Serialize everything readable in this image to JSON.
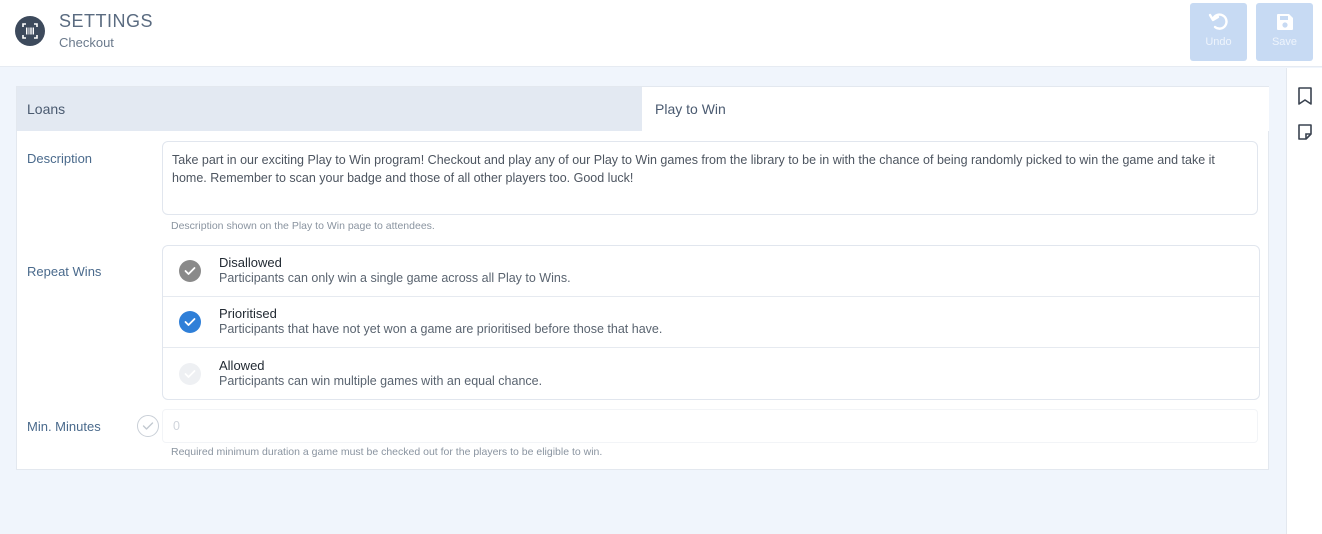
{
  "header": {
    "title": "SETTINGS",
    "subtitle": "Checkout",
    "undo_label": "Undo",
    "save_label": "Save"
  },
  "tabs": [
    {
      "label": "Loans",
      "active": false
    },
    {
      "label": "Play to Win",
      "active": true
    }
  ],
  "description": {
    "label": "Description",
    "value": "Take part in our exciting Play to Win program! Checkout and play any of our Play to Win games from the library to be in with the chance of being randomly picked to win the game and take it home. Remember to scan your badge and those of all other players too. Good luck!",
    "hint": "Description shown on the Play to Win page to attendees."
  },
  "repeat_wins": {
    "label": "Repeat Wins",
    "options": [
      {
        "title": "Disallowed",
        "desc": "Participants can only win a single game across all Play to Wins.",
        "state": "grey"
      },
      {
        "title": "Prioritised",
        "desc": "Participants that have not yet won a game are prioritised before those that have.",
        "state": "selected"
      },
      {
        "title": "Allowed",
        "desc": "Participants can win multiple games with an equal chance.",
        "state": "faded"
      }
    ]
  },
  "min_minutes": {
    "label": "Min. Minutes",
    "value": "0",
    "hint": "Required minimum duration a game must be checked out for the players to be eligible to win."
  },
  "colors": {
    "accent": "#2f7fd8",
    "button_disabled": "#c7daf3",
    "background": "#f0f5fc"
  },
  "icons": {
    "app": "barcode-icon",
    "undo": "undo-icon",
    "save": "save-icon",
    "bookmark": "bookmark-icon",
    "note": "note-icon"
  }
}
